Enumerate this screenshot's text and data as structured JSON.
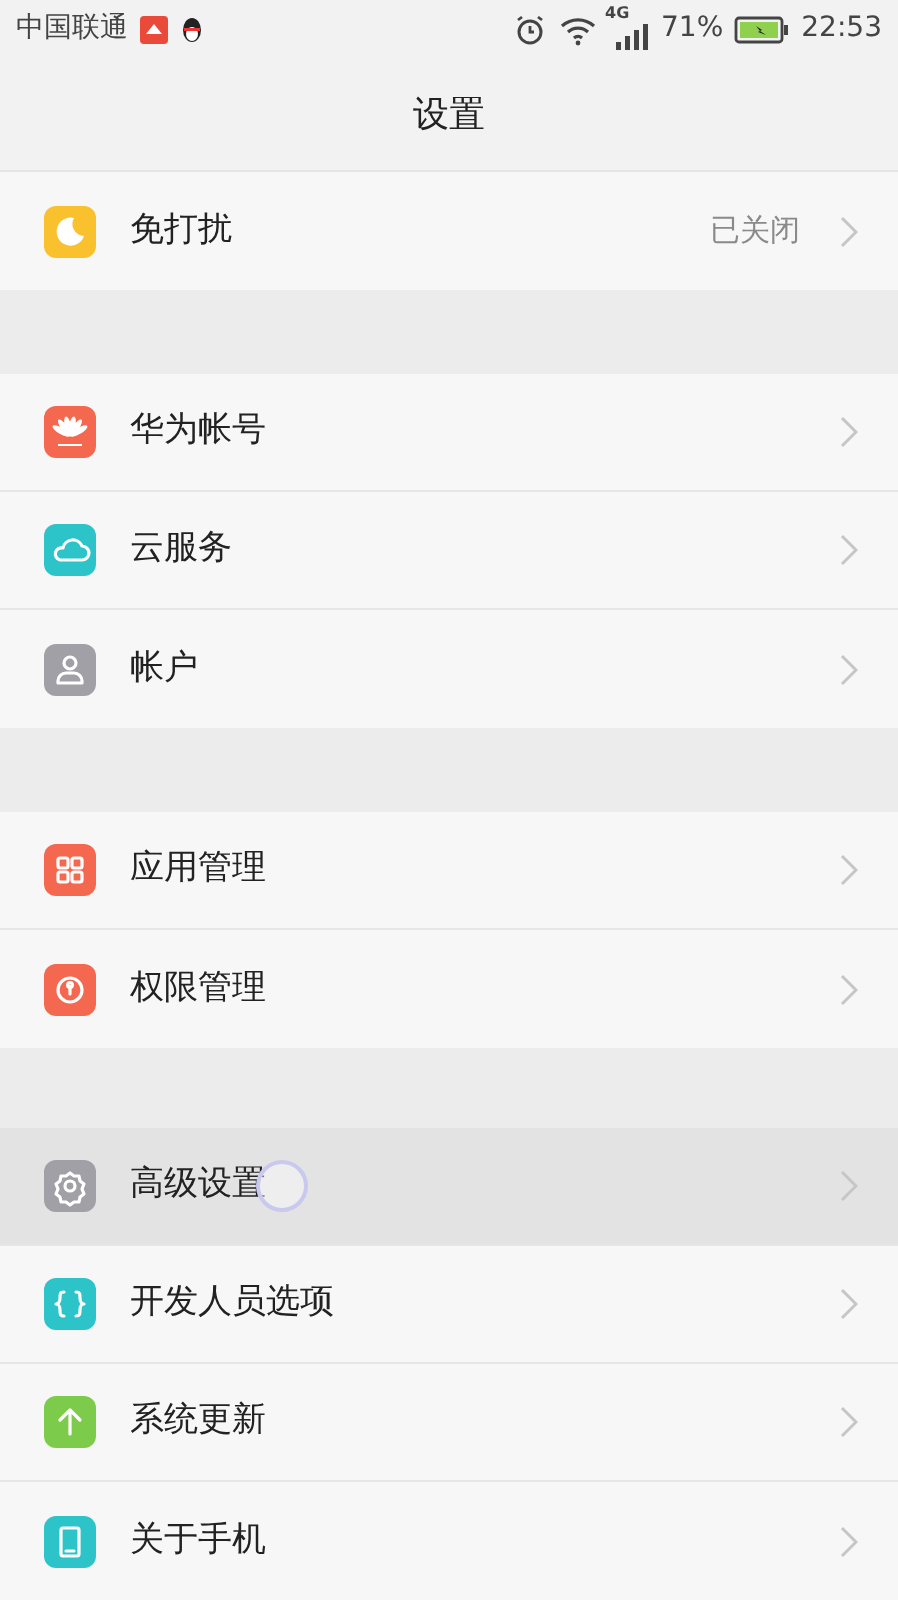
{
  "status_bar": {
    "carrier": "中国联通",
    "network_type": "4G",
    "battery_percent": "71%",
    "time": "22:53"
  },
  "title": "设置",
  "groups": [
    {
      "items": [
        {
          "kind": "moon",
          "color": "#f9c12e",
          "label": "免打扰",
          "value": "已关闭",
          "selected": false
        }
      ]
    },
    {
      "items": [
        {
          "kind": "huawei",
          "color": "#f4684f",
          "label": "华为帐号",
          "selected": false
        },
        {
          "kind": "cloud",
          "color": "#2cc3c9",
          "label": "云服务",
          "selected": false
        },
        {
          "kind": "user",
          "color": "#a0a0a6",
          "label": "帐户",
          "selected": false
        }
      ]
    },
    {
      "items": [
        {
          "kind": "apps",
          "color": "#f4684f",
          "label": "应用管理",
          "selected": false
        },
        {
          "kind": "lock",
          "color": "#f4684f",
          "label": "权限管理",
          "selected": false
        }
      ]
    },
    {
      "items": [
        {
          "kind": "gear",
          "color": "#a0a0a6",
          "label": "高级设置",
          "selected": true
        },
        {
          "kind": "braces",
          "color": "#2cc3c9",
          "label": "开发人员选项",
          "selected": false
        },
        {
          "kind": "arrow",
          "color": "#7ccb4a",
          "label": "系统更新",
          "selected": false
        },
        {
          "kind": "phone",
          "color": "#2cc3c9",
          "label": "关于手机",
          "selected": false
        }
      ]
    }
  ]
}
